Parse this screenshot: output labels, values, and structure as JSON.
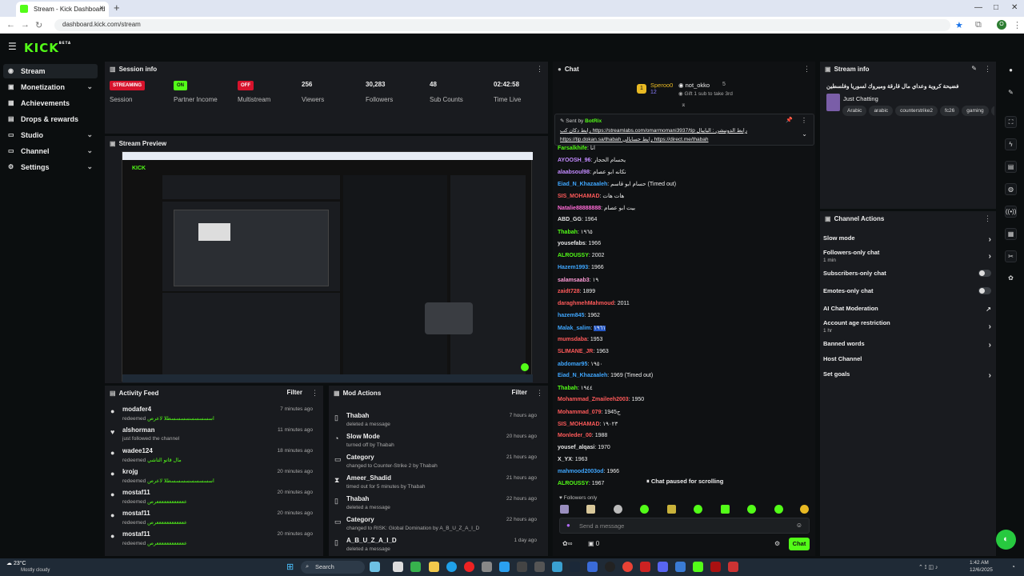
{
  "browser": {
    "tab_title": "Stream - Kick Dashboard",
    "url": "dashboard.kick.com/stream",
    "profile": "O"
  },
  "brand": {
    "logo": "KICK",
    "logo_sup": "BETA",
    "accent": "#53fc18"
  },
  "sidebar": {
    "items": [
      {
        "label": "Stream",
        "icon": "broadcast-icon"
      },
      {
        "label": "Monetization",
        "icon": "dollar-icon"
      },
      {
        "label": "Achievements",
        "icon": "trophy-icon"
      },
      {
        "label": "Drops & rewards",
        "icon": "gift-icon"
      },
      {
        "label": "Studio",
        "icon": "studio-icon"
      },
      {
        "label": "Channel",
        "icon": "user-icon"
      },
      {
        "label": "Settings",
        "icon": "gear-icon"
      }
    ]
  },
  "session": {
    "title": "Session info",
    "stats": [
      {
        "value": "STREAMING",
        "label": "Session"
      },
      {
        "value": "ON",
        "label": "Partner Income"
      },
      {
        "value": "OFF",
        "label": "Multistream"
      },
      {
        "value": "256",
        "label": "Viewers"
      },
      {
        "value": "30,283",
        "label": "Followers"
      },
      {
        "value": "48",
        "label": "Sub Counts"
      },
      {
        "value": "02:42:58",
        "label": "Time Live"
      }
    ]
  },
  "preview": {
    "title": "Stream Preview"
  },
  "activity": {
    "title": "Activity Feed",
    "filter": "Filter",
    "items": [
      {
        "name": "modafer4",
        "action": "redeemed",
        "reward": "اسسسسسسسسسطلا لاعرص",
        "time": "7 minutes ago"
      },
      {
        "name": "alshorman",
        "action": "just followed the channel",
        "reward": "",
        "time": "11 minutes ago"
      },
      {
        "name": "wadee124",
        "action": "redeemed",
        "reward": "مال قاتو التاشي",
        "time": "18 minutes ago"
      },
      {
        "name": "krojg",
        "action": "redeemed",
        "reward": "اسسسسسسسسسطلا لاعرص",
        "time": "20 minutes ago"
      },
      {
        "name": "mostaf11",
        "action": "redeemed",
        "reward": "ععععععععععععرص",
        "time": "20 minutes ago"
      },
      {
        "name": "mostaf11",
        "action": "redeemed",
        "reward": "ععععععععععععرص",
        "time": "20 minutes ago"
      },
      {
        "name": "mostaf11",
        "action": "redeemed",
        "reward": "ععععععععععععرص",
        "time": "20 minutes ago"
      }
    ]
  },
  "mod": {
    "title": "Mod Actions",
    "filter": "Filter",
    "items": [
      {
        "name": "Thabah",
        "action": "deleted a message",
        "time": "7 hours ago"
      },
      {
        "name": "Slow Mode",
        "action": "turned off by Thabah",
        "time": "20 hours ago"
      },
      {
        "name": "Category",
        "action": "changed to Counter-Strike 2 by Thabah",
        "time": "21 hours ago"
      },
      {
        "name": "Ameer_Shadid",
        "action": "timed out for 5 minutes by Thabah",
        "time": "21 hours ago"
      },
      {
        "name": "Thabah",
        "action": "deleted a message",
        "time": "22 hours ago"
      },
      {
        "name": "Category",
        "action": "changed to RISK: Global Domination by A_B_U_Z_A_I_D",
        "time": "22 hours ago"
      },
      {
        "name": "A_B_U_Z_A_I_D",
        "action": "deleted a message",
        "time": "1 day ago"
      }
    ]
  },
  "chat": {
    "title": "Chat",
    "gift": {
      "user": "Speroo0",
      "count": "12",
      "target": "not_okko",
      "points": "5",
      "text": "Gift 1 sub to take 3rd"
    },
    "pinned": {
      "sent_by": "Sent by",
      "bot": "BotRix",
      "line1": "رابط دكان كب https://streamlabs.com/omarmomani3937/tip رابط الدونيشن : البايبال",
      "line2": "https://tip.dokan.sa/thabah رابط حسابالي https://direct.me/thabah"
    },
    "messages": [
      {
        "user": "Farsalkhife",
        "text": "انا",
        "color": "#53fc18"
      },
      {
        "user": "AYOOSH_96",
        "text": "يحسام الحجار",
        "color": "#c38bff"
      },
      {
        "user": "alaabsoul98",
        "text": "نكانه ابو عصام",
        "color": "#c38bff"
      },
      {
        "user": "Eiad_N_Khazaaleh",
        "text": "حسام ابو قاسم (Timed out)",
        "color": "#3fa7ff"
      },
      {
        "user": "SIS_MOHAMAD",
        "text": "هات هات",
        "color": "#ff5a5a"
      },
      {
        "user": "Natalie88888888",
        "text": "بيت ابو عصام",
        "color": "#ff6bd6"
      },
      {
        "user": "ABD_GG",
        "text": "1964",
        "color": "#e6e6e6"
      },
      {
        "user": "Thabah",
        "text": "١٩٦٥",
        "color": "#53fc18"
      },
      {
        "user": "yousefabs",
        "text": "1966",
        "color": "#e6e6e6"
      },
      {
        "user": "ALROUSSY",
        "text": "2002",
        "color": "#53fc18"
      },
      {
        "user": "Hazem1993",
        "text": "1966",
        "color": "#3fa7ff"
      },
      {
        "user": "salamsaab3",
        "text": "١٩",
        "color": "#ff9bd6"
      },
      {
        "user": "zaidt728",
        "text": "1899",
        "color": "#ff5a5a"
      },
      {
        "user": "daraghmehMahmoud",
        "text": "2011",
        "color": "#ff5a5a"
      },
      {
        "user": "hazem845",
        "text": "1962",
        "color": "#3fa7ff"
      },
      {
        "user": "Malak_salim",
        "text": "١٩٦١",
        "color": "#3fa7ff"
      },
      {
        "user": "mumsdaba",
        "text": "1953",
        "color": "#ff5a5a"
      },
      {
        "user": "SLIMANE_JR",
        "text": "1963",
        "color": "#ff5a5a"
      },
      {
        "user": "abdomar95",
        "text": "١٩٥٠",
        "color": "#3fa7ff"
      },
      {
        "user": "Eiad_N_Khazaaleh",
        "text": "1969 (Timed out)",
        "color": "#3fa7ff"
      },
      {
        "user": "Thabah",
        "text": "١٩٤٤",
        "color": "#53fc18"
      },
      {
        "user": "Mohammad_Zmaileeh2003",
        "text": "1950",
        "color": "#ff5a5a"
      },
      {
        "user": "Mohammad_079",
        "text": "1945ج",
        "color": "#ff5a5a"
      },
      {
        "user": "SIS_MOHAMAD",
        "text": "١٩٠٢٣",
        "color": "#ff5a5a"
      },
      {
        "user": "Monleder_00",
        "text": "1988",
        "color": "#ff5a5a"
      },
      {
        "user": "yousef_alqasi",
        "text": "1970",
        "color": "#e6e6e6"
      },
      {
        "user": "X_YX",
        "text": "1963",
        "color": "#e6e6e6"
      },
      {
        "user": "mahmood2003od",
        "text": "1966",
        "color": "#3fa7ff"
      },
      {
        "user": "ALROUSSY",
        "text": "1967",
        "color": "#53fc18"
      }
    ],
    "paused": "Chat paused for scrolling",
    "followers_only": "Followers only",
    "placeholder": "Send a message",
    "count": "0",
    "send": "Chat"
  },
  "streaminfo": {
    "title": "Stream info",
    "stream_title": "فضيحة كروية وعداي مال قارقة وميروك لسوريا وفلسطين",
    "category": "Just Chatting",
    "tags": [
      "Arabic",
      "arabic",
      "counterstrike2",
      "fc26",
      "gaming",
      "pub"
    ]
  },
  "channel_actions": {
    "title": "Channel Actions",
    "items": [
      {
        "label": "Slow mode",
        "sub": "",
        "control": "arrow"
      },
      {
        "label": "Followers-only chat",
        "sub": "1 min",
        "control": "arrow"
      },
      {
        "label": "Subscribers-only chat",
        "sub": "",
        "control": "toggle"
      },
      {
        "label": "Emotes-only chat",
        "sub": "",
        "control": "toggle"
      },
      {
        "label": "AI Chat Moderation",
        "sub": "",
        "control": "external"
      },
      {
        "label": "Account age restriction",
        "sub": "1 hr",
        "control": "arrow"
      },
      {
        "label": "Banned words",
        "sub": "",
        "control": "arrow"
      },
      {
        "label": "Host Channel",
        "sub": "",
        "control": "none"
      },
      {
        "label": "Set goals",
        "sub": "",
        "control": "arrow"
      }
    ]
  },
  "taskbar": {
    "weather_temp": "23°C",
    "weather_text": "Mostly cloudy",
    "search": "Search",
    "time": "1:42 AM",
    "date": "12/6/2025",
    "lang": "ENG\nUS"
  }
}
